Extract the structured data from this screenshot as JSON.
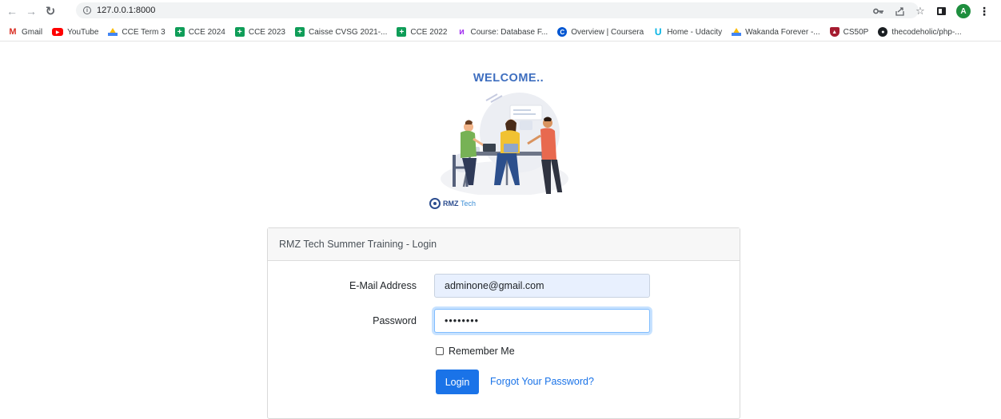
{
  "browser": {
    "url": "127.0.0.1:8000",
    "avatar_letter": "A",
    "bookmarks": [
      {
        "label": "Gmail",
        "icon": "gmail-icon"
      },
      {
        "label": "YouTube",
        "icon": "youtube-icon"
      },
      {
        "label": "CCE Term 3",
        "icon": "google-drive-icon"
      },
      {
        "label": "CCE 2024",
        "icon": "google-sheets-icon"
      },
      {
        "label": "CCE 2023",
        "icon": "google-sheets-icon"
      },
      {
        "label": "Caisse CVSG 2021-...",
        "icon": "google-sheets-icon"
      },
      {
        "label": "CCE 2022",
        "icon": "google-sheets-icon"
      },
      {
        "label": "Course: Database F...",
        "icon": "udemy-icon"
      },
      {
        "label": "Overview | Coursera",
        "icon": "coursera-icon"
      },
      {
        "label": "Home - Udacity",
        "icon": "udacity-icon"
      },
      {
        "label": "Wakanda Forever -...",
        "icon": "google-drive-icon"
      },
      {
        "label": "CS50P",
        "icon": "cs50-icon"
      },
      {
        "label": "thecodeholic/php-...",
        "icon": "github-icon"
      }
    ]
  },
  "page": {
    "welcome": "WELCOME..",
    "logo": {
      "brand": "RMZ",
      "suffix": "Tech"
    },
    "card": {
      "title": "RMZ Tech Summer Training - Login",
      "email_label": "E-Mail Address",
      "email_value": "adminone@gmail.com",
      "password_label": "Password",
      "password_value": "12345678",
      "remember_label": "Remember Me",
      "remember_checked": false,
      "login_button": "Login",
      "forgot_link": "Forgot Your Password?"
    }
  },
  "colors": {
    "welcome": "#3e6ebf",
    "primary_button": "#1a73e8",
    "link": "#1a73e8",
    "focus_ring": "#80bdff",
    "autofill_bg": "#e8f0fe"
  }
}
